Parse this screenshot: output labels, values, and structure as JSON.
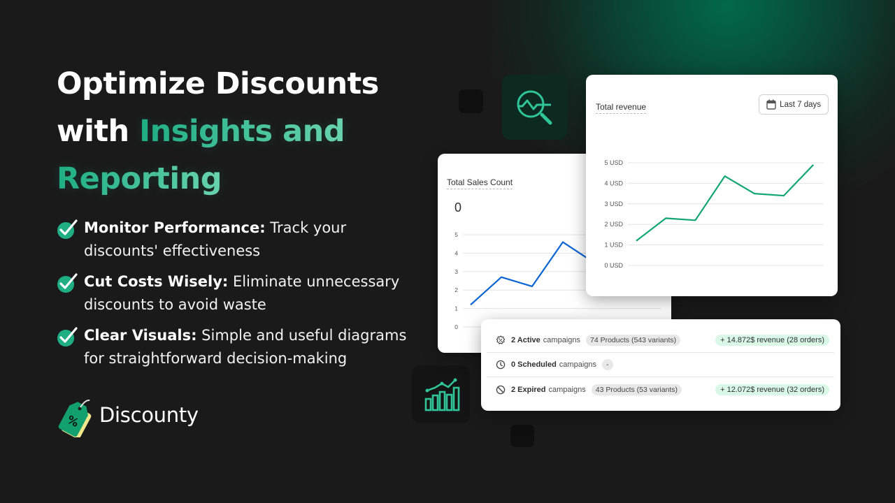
{
  "headline": {
    "line1": "Optimize Discounts",
    "line2_plain": "with ",
    "line2_accent": "Insights and",
    "line3_accent": "Reporting"
  },
  "features": [
    {
      "title": "Monitor Performance:",
      "text": " Track your discounts' effectiveness",
      "icon": "check-circle-icon"
    },
    {
      "title": "Cut Costs Wisely:",
      "text": " Eliminate unnecessary discounts to avoid waste",
      "icon": "check-circle-icon"
    },
    {
      "title": "Clear Visuals:",
      "text": " Simple and useful diagrams for straightforward decision-making",
      "icon": "check-circle-icon"
    }
  ],
  "brand": {
    "name": "Discounty",
    "logo": "price-tag-percent-icon"
  },
  "icons": {
    "analytics_tile": "magnifier-chart-icon",
    "growth_tile": "bar-chart-trend-icon"
  },
  "colors": {
    "accent": "#1fae82",
    "revenue_line": "#12a575",
    "sales_line": "#0a65d3",
    "background": "#1a1a1a",
    "revenue_pill": "#d9f8e8"
  },
  "revenue_card": {
    "title": "Total revenue",
    "date_range_label": "Last 7 days"
  },
  "sales_card": {
    "title": "Total Sales Count",
    "big_number": "0"
  },
  "chart_data": [
    {
      "type": "line",
      "title": "Total revenue",
      "ylabel": "",
      "xlabel": "",
      "y_tick_labels": [
        "0 USD",
        "1 USD",
        "2 USD",
        "3 USD",
        "4 USD",
        "5 USD"
      ],
      "ylim": [
        0,
        5
      ],
      "grid": true,
      "series": [
        {
          "name": "Revenue",
          "values": [
            1.2,
            2.3,
            2.2,
            4.35,
            3.5,
            3.4,
            4.9
          ]
        }
      ]
    },
    {
      "type": "line",
      "title": "Total Sales Count",
      "ylabel": "",
      "xlabel": "",
      "y_tick_labels": [
        "0",
        "1",
        "2",
        "3",
        "4",
        "5"
      ],
      "ylim": [
        0,
        5
      ],
      "grid": true,
      "series": [
        {
          "name": "Sales",
          "values": [
            1.2,
            2.7,
            2.2,
            4.6,
            3.5
          ]
        }
      ]
    }
  ],
  "campaigns": [
    {
      "icon": "discount-badge-icon",
      "count": "2 Active",
      "label": "campaigns",
      "products": "74 Products (543 variants)",
      "revenue": "+ 14.872$ revenue (28 orders)"
    },
    {
      "icon": "clock-icon",
      "count": "0 Scheduled",
      "label": "campaigns",
      "products": "-",
      "revenue": null
    },
    {
      "icon": "prohibited-icon",
      "count": "2 Expired",
      "label": "campaigns",
      "products": "43 Products (53 variants)",
      "revenue": "+ 12.072$ revenue (32 orders)"
    }
  ]
}
